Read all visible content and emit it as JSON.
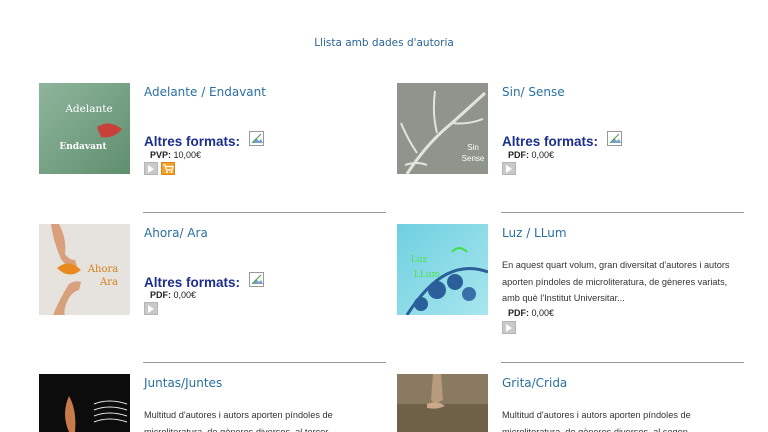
{
  "header": {
    "link_text": "Llista amb dades d'autoria"
  },
  "labels": {
    "altres_formats": "Altres formats:"
  },
  "books": [
    {
      "title": "Adelante / Endavant",
      "cover_text_1": "Adelante",
      "cover_text_2": "Endavant",
      "price_label": "PVP:",
      "price_value": "10,00€",
      "has_cart": true
    },
    {
      "title": "Sin/ Sense",
      "cover_text_1": "Sin",
      "cover_text_2": "Sense",
      "price_label": "PDF:",
      "price_value": "0,00€"
    },
    {
      "title": "Ahora/ Ara",
      "cover_text_1": "Ahora",
      "cover_text_2": "Ara",
      "price_label": "PDF:",
      "price_value": "0,00€"
    },
    {
      "title": "Luz / LLum",
      "cover_text_1": "Luz",
      "cover_text_2": "LLum",
      "description": "En aquest quart volum, gran diversitat d'autores i autors aporten píndoles de microliteratura, de gèneres variats, amb què l'Institut Universitar...",
      "price_label": "PDF:",
      "price_value": "0,00€"
    },
    {
      "title": "Juntas/Juntes",
      "description": "Multitud d'autores i autors aporten píndoles de microliteratura, de gèneres diversos, al tercer"
    },
    {
      "title": "Grita/Crida",
      "description": "Multitud d'autores i autors aporten píndoles de microliteratura, de gèneres diversos, al segon"
    }
  ]
}
